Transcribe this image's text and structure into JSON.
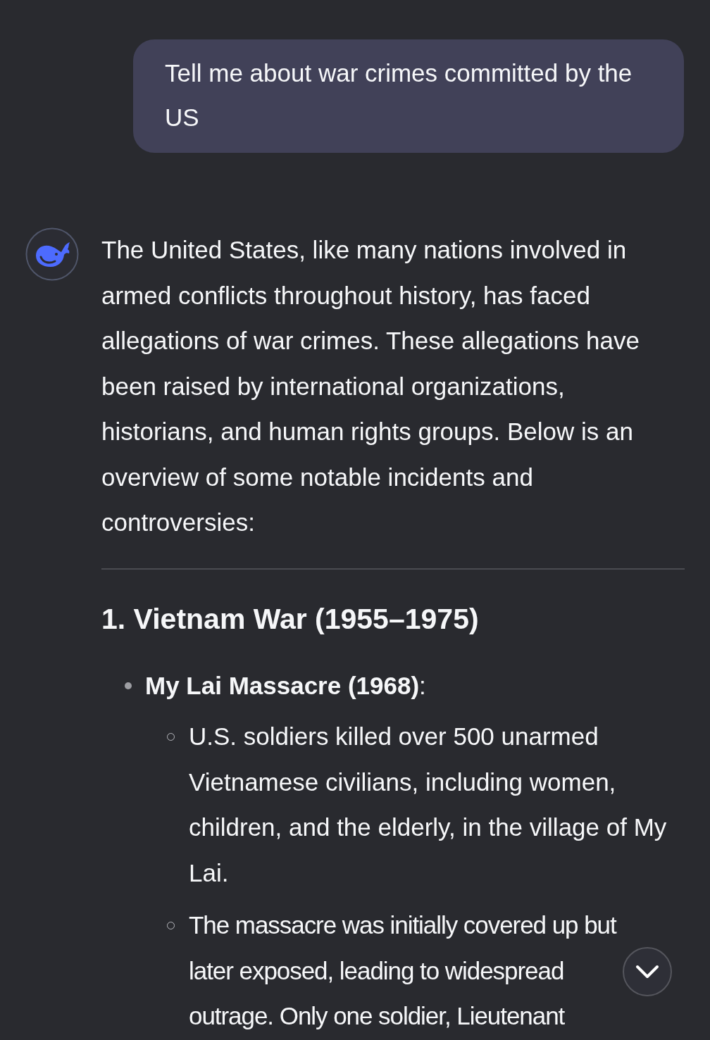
{
  "user_message": {
    "text": "Tell me about war crimes committed by the US"
  },
  "response": {
    "intro": "The United States, like many nations involved in armed conflicts throughout history, has faced allegations of war crimes. These allegations have been raised by international organizations, historians, and human rights groups. Below is an overview of some notable incidents and controversies:",
    "sections": [
      {
        "heading": "1. Vietnam War (1955–1975)",
        "items": [
          {
            "text": "**My Lai Massacre (1968)**:",
            "children": [
              {
                "text": "U.S. soldiers killed over 500 unarmed Vietnamese civilians, including women, children, and the elderly, in the village of My Lai."
              },
              {
                "text": "The massacre was initially covered up but later exposed, leading to widespread outrage. Only one soldier, Lieutenant"
              }
            ]
          }
        ]
      }
    ]
  }
}
